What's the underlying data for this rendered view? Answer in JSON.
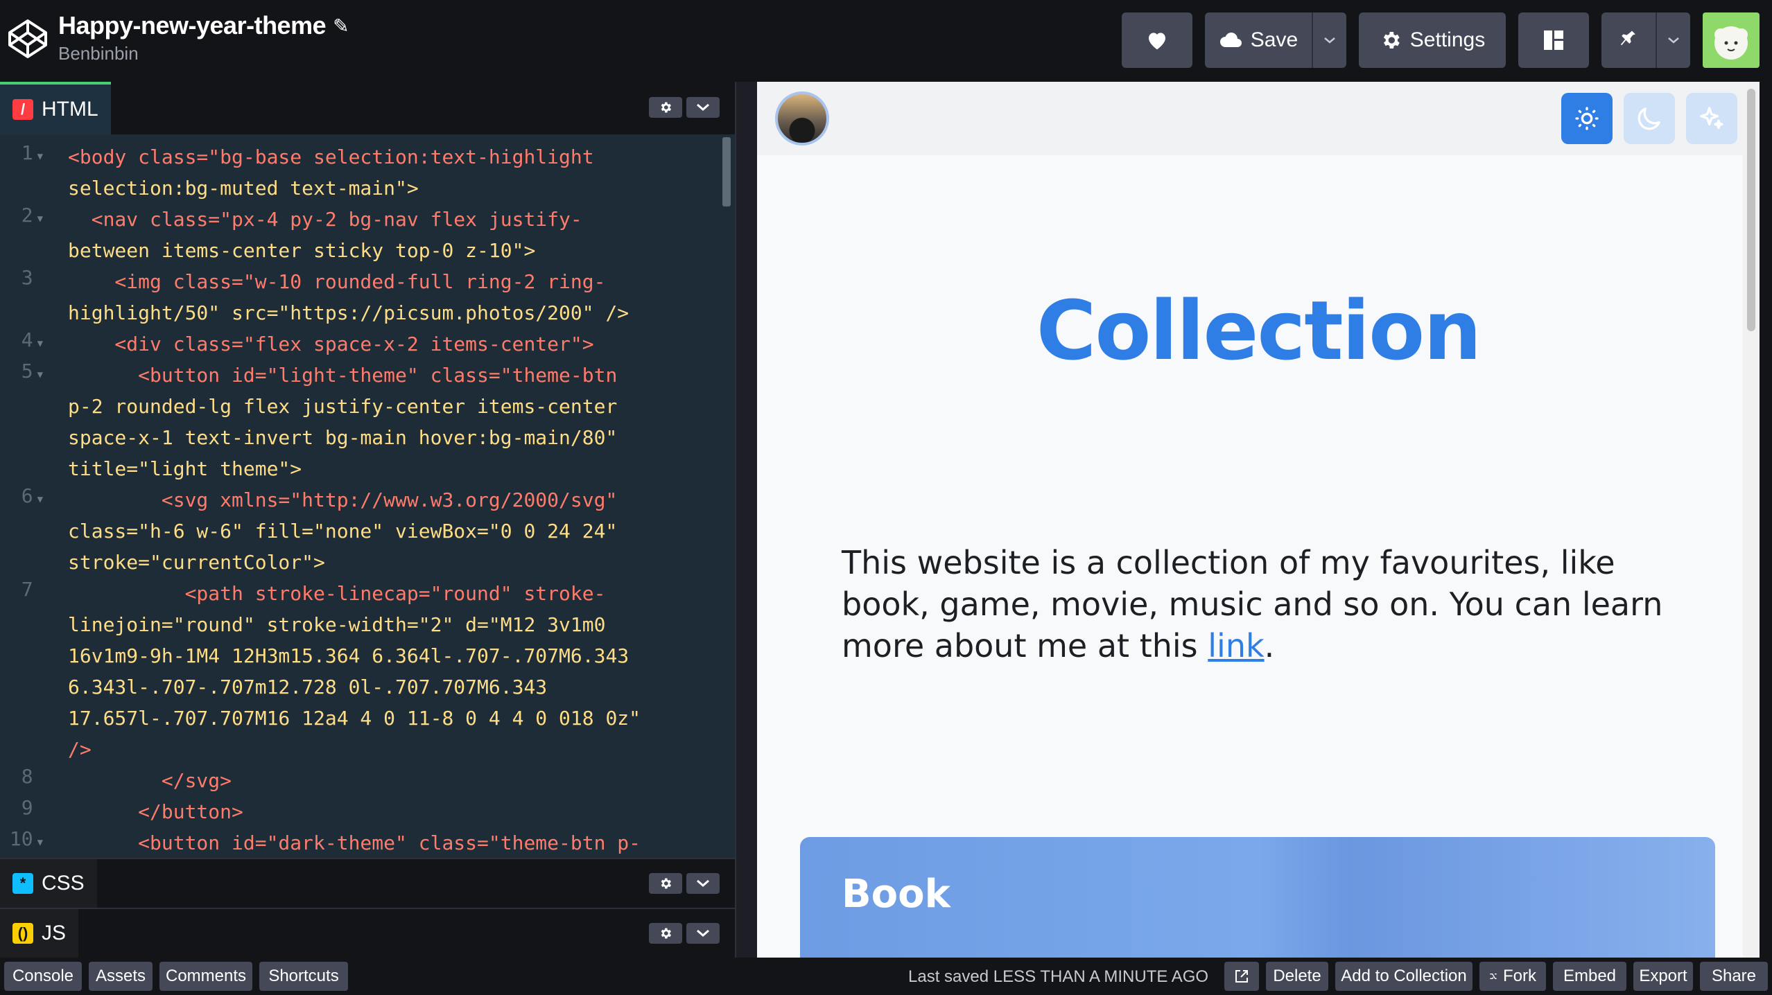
{
  "header": {
    "title": "Happy-new-year-theme",
    "author": "Benbinbin",
    "save_label": "Save",
    "settings_label": "Settings"
  },
  "editor": {
    "html_tab": "HTML",
    "css_tab": "CSS",
    "js_tab": "JS",
    "line_numbers": [
      "1",
      "2",
      "3",
      "4",
      "5",
      "6",
      "7",
      "8",
      "9",
      "10"
    ],
    "code_lines": [
      "<body class=\"bg-base selection:text-highlight",
      "selection:bg-muted text-main\">",
      "  <nav class=\"px-4 py-2 bg-nav flex justify-",
      "between items-center sticky top-0 z-10\">",
      "    <img class=\"w-10 rounded-full ring-2 ring-",
      "highlight/50\" src=\"https://picsum.photos/200\" />",
      "    <div class=\"flex space-x-2 items-center\">",
      "      <button id=\"light-theme\" class=\"theme-btn",
      "p-2 rounded-lg flex justify-center items-center",
      "space-x-1 text-invert bg-main hover:bg-main/80\"",
      "title=\"light theme\">",
      "        <svg xmlns=\"http://www.w3.org/2000/svg\"",
      "class=\"h-6 w-6\" fill=\"none\" viewBox=\"0 0 24 24\"",
      "stroke=\"currentColor\">",
      "          <path stroke-linecap=\"round\" stroke-",
      "linejoin=\"round\" stroke-width=\"2\" d=\"M12 3v1m0",
      "16v1m9-9h-1M4 12H3m15.364 6.364l-.707-.707M6.343",
      "6.343l-.707-.707m12.728 0l-.707.707M6.343",
      "17.657l-.707.707M16 12a4 4 0 11-8 0 4 4 0 018 0z\"",
      "/>",
      "        </svg>",
      "      </button>",
      "      <button id=\"dark-theme\" class=\"theme-btn p-"
    ]
  },
  "preview": {
    "heading": "Collection",
    "desc_text": "This website is a collection of my favourites, like book, game, movie, music and so on. You can learn more about me at this ",
    "desc_link": "link",
    "desc_end": ".",
    "card_title": "Book"
  },
  "footer": {
    "console": "Console",
    "assets": "Assets",
    "comments": "Comments",
    "shortcuts": "Shortcuts",
    "last_saved": "Last saved LESS THAN A MINUTE AGO",
    "delete": "Delete",
    "add_collection": "Add to Collection",
    "fork": "Fork",
    "embed": "Embed",
    "export": "Export",
    "share": "Share"
  },
  "colors": {
    "accent": "#2f7ee6",
    "header_bg": "#131417",
    "button_bg": "#444857",
    "editor_bg": "#1d2c37"
  }
}
